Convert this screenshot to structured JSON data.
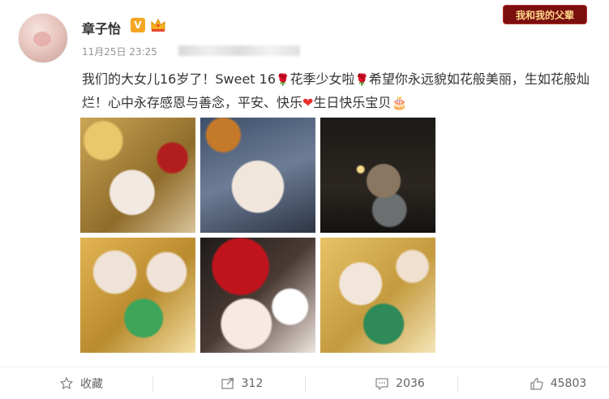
{
  "post": {
    "username": "章子怡",
    "verify_badge": "V",
    "timestamp": "11月25日 23:25",
    "meta_sep": "来",
    "corner_badge": "我和我的父辈",
    "text_part1": "我们的大女儿16岁了！Sweet 16",
    "text_part2": "花季少女啦",
    "text_part3": "希望你永远貌如花般美丽，生如花般灿烂！心中永存感恩与善念，平安、快乐",
    "text_part4": "生日快乐宝贝",
    "emoji_rose": "🌹",
    "emoji_heart": "❤",
    "emoji_cake": "🎂"
  },
  "footer": {
    "favorite_label": "收藏",
    "repost_count": "312",
    "comment_count": "2036",
    "like_count": "45803"
  },
  "colors": {
    "accent_red": "#d0021b",
    "verify_gold": "#f5a623",
    "meta_gray": "#939393"
  }
}
